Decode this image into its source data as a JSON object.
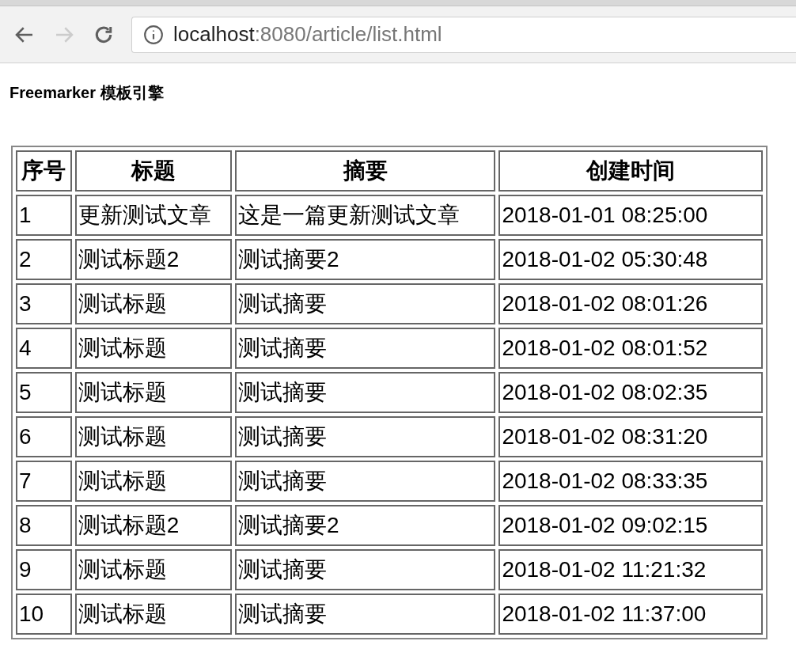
{
  "browser": {
    "url_host": "localhost",
    "url_rest": ":8080/article/list.html",
    "forward_disabled": true
  },
  "heading": "Freemarker 模板引擎",
  "table": {
    "columns": [
      "序号",
      "标题",
      "摘要",
      "创建时间"
    ],
    "rows": [
      [
        "1",
        "更新测试文章",
        "这是一篇更新测试文章",
        "2018-01-01 08:25:00"
      ],
      [
        "2",
        "测试标题2",
        "测试摘要2",
        "2018-01-02 05:30:48"
      ],
      [
        "3",
        "测试标题",
        "测试摘要",
        "2018-01-02 08:01:26"
      ],
      [
        "4",
        "测试标题",
        "测试摘要",
        "2018-01-02 08:01:52"
      ],
      [
        "5",
        "测试标题",
        "测试摘要",
        "2018-01-02 08:02:35"
      ],
      [
        "6",
        "测试标题",
        "测试摘要",
        "2018-01-02 08:31:20"
      ],
      [
        "7",
        "测试标题",
        "测试摘要",
        "2018-01-02 08:33:35"
      ],
      [
        "8",
        "测试标题2",
        "测试摘要2",
        "2018-01-02 09:02:15"
      ],
      [
        "9",
        "测试标题",
        "测试摘要",
        "2018-01-02 11:21:32"
      ],
      [
        "10",
        "测试标题",
        "测试摘要",
        "2018-01-02 11:37:00"
      ]
    ]
  }
}
